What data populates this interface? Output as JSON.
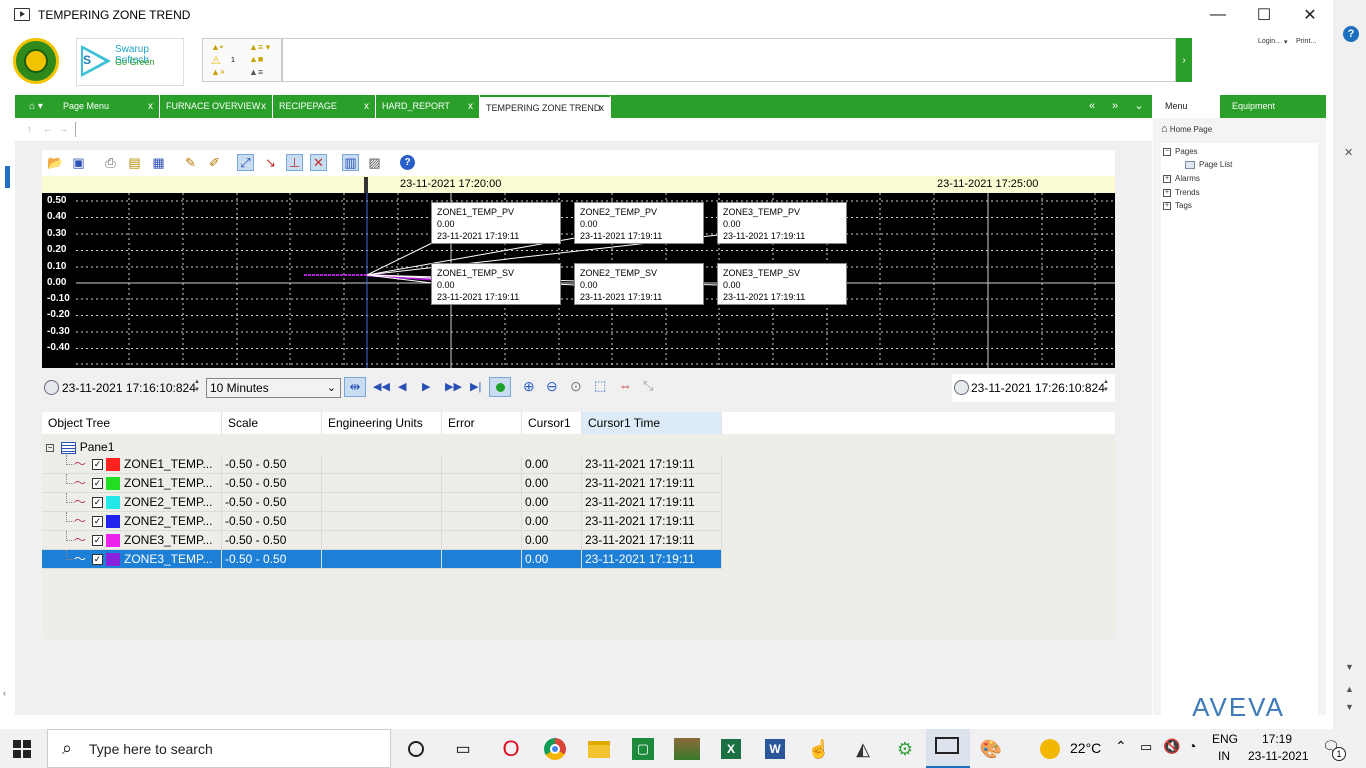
{
  "window": {
    "title": "TEMPERING ZONE TREND",
    "minimize": "—",
    "maximize": "☐",
    "close": "✕"
  },
  "header": {
    "brand_name": "Swarup Softech",
    "brand_tagline": "Go Green",
    "brand_letter": "S",
    "alarm_count": "1",
    "alarm_go": "›",
    "login_link": "Login...",
    "print_link": "Print..."
  },
  "tabs": [
    {
      "label": "Page Menu",
      "close": "x"
    },
    {
      "label": "FURNACE OVERVIEW",
      "close": "x"
    },
    {
      "label": "RECIPEPAGE",
      "close": "x"
    },
    {
      "label": "HARD_REPORT",
      "close": "x"
    },
    {
      "label": "TEMPERING ZONE TREND",
      "close": "x"
    }
  ],
  "tab_nav": {
    "first": "«",
    "last": "»",
    "menu": "⌄"
  },
  "right_panel": {
    "tabs": [
      "Menu",
      "Equipment"
    ],
    "home": "Home Page",
    "tree": [
      {
        "label": "Pages",
        "expander": "−",
        "children": [
          "Page List"
        ]
      },
      {
        "label": "Alarms",
        "expander": "+"
      },
      {
        "label": "Trends",
        "expander": "+"
      },
      {
        "label": "Tags",
        "expander": "+"
      }
    ],
    "logo": "AVEVA"
  },
  "trend": {
    "time_labels": [
      "23-11-2021 17:20:00",
      "23-11-2021 17:25:00"
    ],
    "y_labels": [
      "0.50",
      "0.40",
      "0.30",
      "0.20",
      "0.10",
      "0.00",
      "-0.10",
      "-0.20",
      "-0.30",
      "-0.40"
    ],
    "callouts": [
      {
        "name": "ZONE1_TEMP_PV",
        "value": "0.00",
        "time": "23-11-2021 17:19:11"
      },
      {
        "name": "ZONE2_TEMP_PV",
        "value": "0.00",
        "time": "23-11-2021 17:19:11"
      },
      {
        "name": "ZONE3_TEMP_PV",
        "value": "0.00",
        "time": "23-11-2021 17:19:11"
      },
      {
        "name": "ZONE1_TEMP_SV",
        "value": "0.00",
        "time": "23-11-2021 17:19:11"
      },
      {
        "name": "ZONE2_TEMP_SV",
        "value": "0.00",
        "time": "23-11-2021 17:19:11"
      },
      {
        "name": "ZONE3_TEMP_SV",
        "value": "0.00",
        "time": "23-11-2021 17:19:11"
      }
    ],
    "start_time": "23-11-2021 17:16:10:824",
    "end_time": "23-11-2021 17:26:10:824",
    "duration": "10 Minutes",
    "duration_arrow": "⌄"
  },
  "grid": {
    "columns": [
      "Object Tree",
      "Scale",
      "Engineering Units",
      "Error",
      "Cursor1",
      "Cursor1 Time"
    ],
    "pane": "Pane1",
    "pane_expander": "−",
    "rows": [
      {
        "name": "ZONE1_TEMP...",
        "scale": "-0.50 - 0.50",
        "units": "",
        "error": "",
        "cursor": "0.00",
        "time": "23-11-2021 17:19:11",
        "color": "#ff2020",
        "selected": false
      },
      {
        "name": "ZONE1_TEMP...",
        "scale": "-0.50 - 0.50",
        "units": "",
        "error": "",
        "cursor": "0.00",
        "time": "23-11-2021 17:19:11",
        "color": "#22dd22",
        "selected": false
      },
      {
        "name": "ZONE2_TEMP...",
        "scale": "-0.50 - 0.50",
        "units": "",
        "error": "",
        "cursor": "0.00",
        "time": "23-11-2021 17:19:11",
        "color": "#22e8e8",
        "selected": false
      },
      {
        "name": "ZONE2_TEMP...",
        "scale": "-0.50 - 0.50",
        "units": "",
        "error": "",
        "cursor": "0.00",
        "time": "23-11-2021 17:19:11",
        "color": "#2222ee",
        "selected": false
      },
      {
        "name": "ZONE3_TEMP...",
        "scale": "-0.50 - 0.50",
        "units": "",
        "error": "",
        "cursor": "0.00",
        "time": "23-11-2021 17:19:11",
        "color": "#ee22ee",
        "selected": false
      },
      {
        "name": "ZONE3_TEMP...",
        "scale": "-0.50 - 0.50",
        "units": "",
        "error": "",
        "cursor": "0.00",
        "time": "23-11-2021 17:19:11",
        "color": "#8a22dd",
        "selected": true
      }
    ]
  },
  "taskbar": {
    "search_placeholder": "Type here to search",
    "weather": "22°C",
    "lang": "ENG",
    "region": "IN",
    "time": "17:19",
    "date": "23-11-2021",
    "notif_count": "1"
  }
}
